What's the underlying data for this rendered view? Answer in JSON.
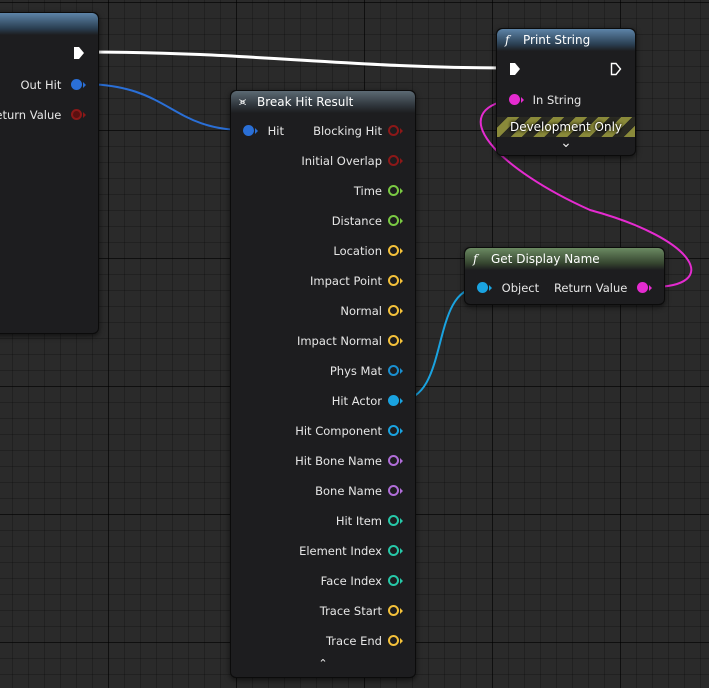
{
  "colors": {
    "exec_wire": "#ffffff",
    "struct_wire": "#2a6fd6",
    "object_wire": "#1aa3e0",
    "string_wire": "#e52bd0",
    "bool": "#8c1818",
    "float": "#7ac943",
    "vector": "#f4c13a",
    "physmat": "#1a8fd0",
    "object": "#1aa3e0",
    "name": "#b06dd8",
    "int": "#27c8a8",
    "string": "#e52bd0"
  },
  "left_node": {
    "pins": [
      {
        "label": "Out Hit",
        "color": "#2a6fd6",
        "filled": true
      },
      {
        "label": "Return Value",
        "color": "#8c1818",
        "filled": true
      }
    ]
  },
  "break_hit": {
    "title": "Break Hit Result",
    "icon": "break-struct-icon",
    "input": {
      "label": "Hit",
      "color": "#2a6fd6"
    },
    "outputs": [
      {
        "label": "Blocking Hit",
        "color": "#8c1818"
      },
      {
        "label": "Initial Overlap",
        "color": "#8c1818"
      },
      {
        "label": "Time",
        "color": "#7ac943"
      },
      {
        "label": "Distance",
        "color": "#7ac943"
      },
      {
        "label": "Location",
        "color": "#f4c13a"
      },
      {
        "label": "Impact Point",
        "color": "#f4c13a"
      },
      {
        "label": "Normal",
        "color": "#f4c13a"
      },
      {
        "label": "Impact Normal",
        "color": "#f4c13a"
      },
      {
        "label": "Phys Mat",
        "color": "#1a8fd0"
      },
      {
        "label": "Hit Actor",
        "color": "#1aa3e0",
        "filled": true
      },
      {
        "label": "Hit Component",
        "color": "#1aa3e0"
      },
      {
        "label": "Hit Bone Name",
        "color": "#b06dd8"
      },
      {
        "label": "Bone Name",
        "color": "#b06dd8"
      },
      {
        "label": "Hit Item",
        "color": "#27c8a8"
      },
      {
        "label": "Element Index",
        "color": "#27c8a8"
      },
      {
        "label": "Face Index",
        "color": "#27c8a8"
      },
      {
        "label": "Trace Start",
        "color": "#f4c13a"
      },
      {
        "label": "Trace End",
        "color": "#f4c13a"
      }
    ],
    "collapse_glyph": "⌃"
  },
  "print_string": {
    "title": "Print String",
    "icon": "function-icon",
    "icon_glyph": "f",
    "in_string": "In String",
    "dev_only": "Development Only",
    "expand_glyph": "⌄"
  },
  "get_display_name": {
    "title": "Get Display Name",
    "icon": "function-icon",
    "icon_glyph": "f",
    "object_label": "Object",
    "return_label": "Return Value"
  }
}
